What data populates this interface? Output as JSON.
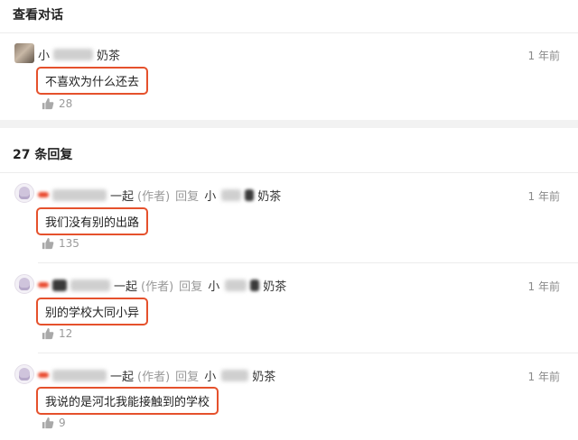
{
  "header": {
    "title": "查看对话"
  },
  "original": {
    "name_visible": "小",
    "name_tail": "奶茶",
    "time": "1 年前",
    "text": "不喜欢为什么还去",
    "likes": "28"
  },
  "replies_header": {
    "title": "27 条回复"
  },
  "replies": [
    {
      "name_tail": "一起",
      "author_tag": "(作者)",
      "reply_word": "回复",
      "target_head": "小",
      "target_tail": "奶茶",
      "time": "1 年前",
      "text": "我们没有别的出路",
      "likes": "135"
    },
    {
      "name_tail": "一起",
      "author_tag": "(作者)",
      "reply_word": "回复",
      "target_head": "小",
      "target_tail": "奶茶",
      "time": "1 年前",
      "text": "别的学校大同小异",
      "likes": "12"
    },
    {
      "name_tail": "一起",
      "author_tag": "(作者)",
      "reply_word": "回复",
      "target_head": "小",
      "target_tail": "奶茶",
      "time": "1 年前",
      "text": "我说的是河北我能接触到的学校",
      "likes": "9"
    }
  ],
  "colors": {
    "highlight": "#e5512c",
    "meta": "#999999",
    "gap": "#f2f2f2"
  }
}
